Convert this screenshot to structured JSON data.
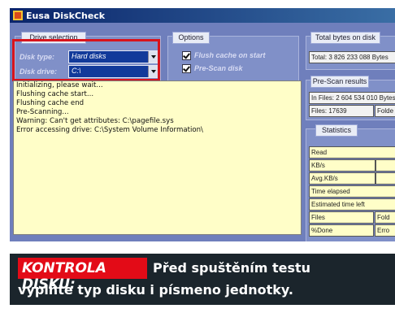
{
  "window": {
    "title": "Eusa DiskCheck"
  },
  "drive_selection": {
    "group_label": "Drive selection",
    "disk_type_label": "Disk type:",
    "disk_type_value": "Hard disks",
    "disk_drive_label": "Disk drive:",
    "disk_drive_value": "C:\\"
  },
  "options": {
    "group_label": "Options",
    "flush_cache_label": "Flush cache on start",
    "pre_scan_label": "Pre-Scan disk"
  },
  "total_bytes": {
    "group_label": "Total bytes on disk",
    "value": "Total: 3 826 233 088 Bytes"
  },
  "prescan": {
    "group_label": "Pre-Scan results",
    "in_files": "In Files: 2 604 534 010 Bytes",
    "files": "Files: 17639",
    "folders": "Folde"
  },
  "statistics": {
    "group_label": "Statistics",
    "read": "Read",
    "kb_s": "KB/s",
    "avg_kb_s": "Avg.KB/s",
    "time_elapsed": "Time elapsed",
    "estimated_time_left": "Estimated time left",
    "files": "Files",
    "folders": "Fold",
    "done": "%Done",
    "errors": "Erro"
  },
  "log": {
    "lines": [
      "Initializing, please wait...",
      "Flushing cache start...",
      "Flushing cache end",
      "Pre-Scanning...",
      "Warning: Can't get attributes: C:\\pagefile.sys",
      "Error accessing drive: C:\\System Volume Information\\"
    ]
  },
  "caption": {
    "highlight": "KONTROLA DISKU:",
    "line1": "Před spuštěním testu",
    "line2": "vyplňte typ disku i písmeno jednotky."
  },
  "colors": {
    "caption_red": "#e30b17",
    "caption_bg": "#1b252c",
    "window_bg": "#6f7fbc",
    "log_bg": "#fffec8"
  }
}
